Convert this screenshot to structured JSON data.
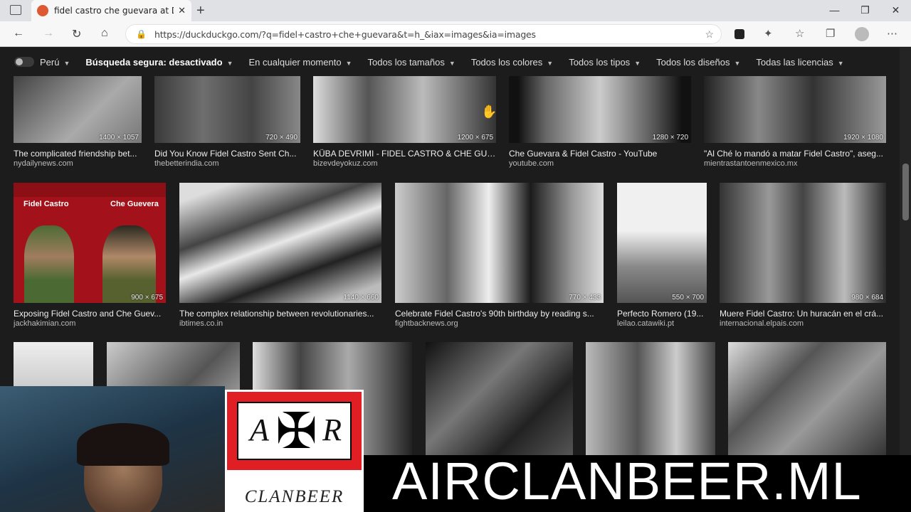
{
  "browser": {
    "tab_title": "fidel castro che guevara at Duck",
    "tab_close": "✕",
    "new_tab": "+",
    "url": "https://duckduckgo.com/?q=fidel+castro+che+guevara&t=h_&iax=images&ia=images"
  },
  "filters": {
    "region": "Perú",
    "safe_search": "Búsqueda segura: desactivado",
    "time": "En cualquier momento",
    "size": "Todos los tamaños",
    "color": "Todos los colores",
    "type": "Todos los tipos",
    "layout": "Todos los diseños",
    "license": "Todas las licencias"
  },
  "results": {
    "row1": [
      {
        "caption": "The complicated friendship bet...",
        "source": "nydailynews.com",
        "dims": "1400 × 1057"
      },
      {
        "caption": "Did You Know Fidel Castro Sent Ch...",
        "source": "thebetterindia.com",
        "dims": "720 × 490"
      },
      {
        "caption": "KÜBA DEVRIMI - FIDEL CASTRO & CHE GUE...",
        "source": "bizevdeyokuz.com",
        "dims": "1200 × 675"
      },
      {
        "caption": "Che Guevara & Fidel Castro - YouTube",
        "source": "youtube.com",
        "dims": "1280 × 720"
      },
      {
        "caption": "\"Al Ché lo mandó a matar Fidel Castro\", aseg...",
        "source": "mientrastantoenmexico.mx",
        "dims": "1920 × 1080"
      }
    ],
    "row2": [
      {
        "caption": "Exposing Fidel Castro and Che Guev...",
        "source": "jackhakimian.com",
        "dims": "900 × 675",
        "label_left": "Fidel Castro",
        "label_right": "Che Guevera"
      },
      {
        "caption": "The complex relationship between revolutionaries...",
        "source": "ibtimes.co.in",
        "dims": "1140 × 660"
      },
      {
        "caption": "Celebrate Fidel Castro's 90th birthday by reading s...",
        "source": "fightbacknews.org",
        "dims": "770 × 433"
      },
      {
        "caption": "Perfecto Romero (19...",
        "source": "leilao.catawiki.pt",
        "dims": "550 × 700"
      },
      {
        "caption": "Muere Fidel Castro: Un huracán en el crá...",
        "source": "internacional.elpais.com",
        "dims": "980 × 684"
      }
    ]
  },
  "overlay": {
    "logo_left": "A",
    "logo_right": "R",
    "logo_text": "CLANBEER",
    "banner": "AIRCLANBEER.ML"
  },
  "colors": {
    "duck_orange": "#de5833",
    "flag_red": "#e21e25"
  }
}
